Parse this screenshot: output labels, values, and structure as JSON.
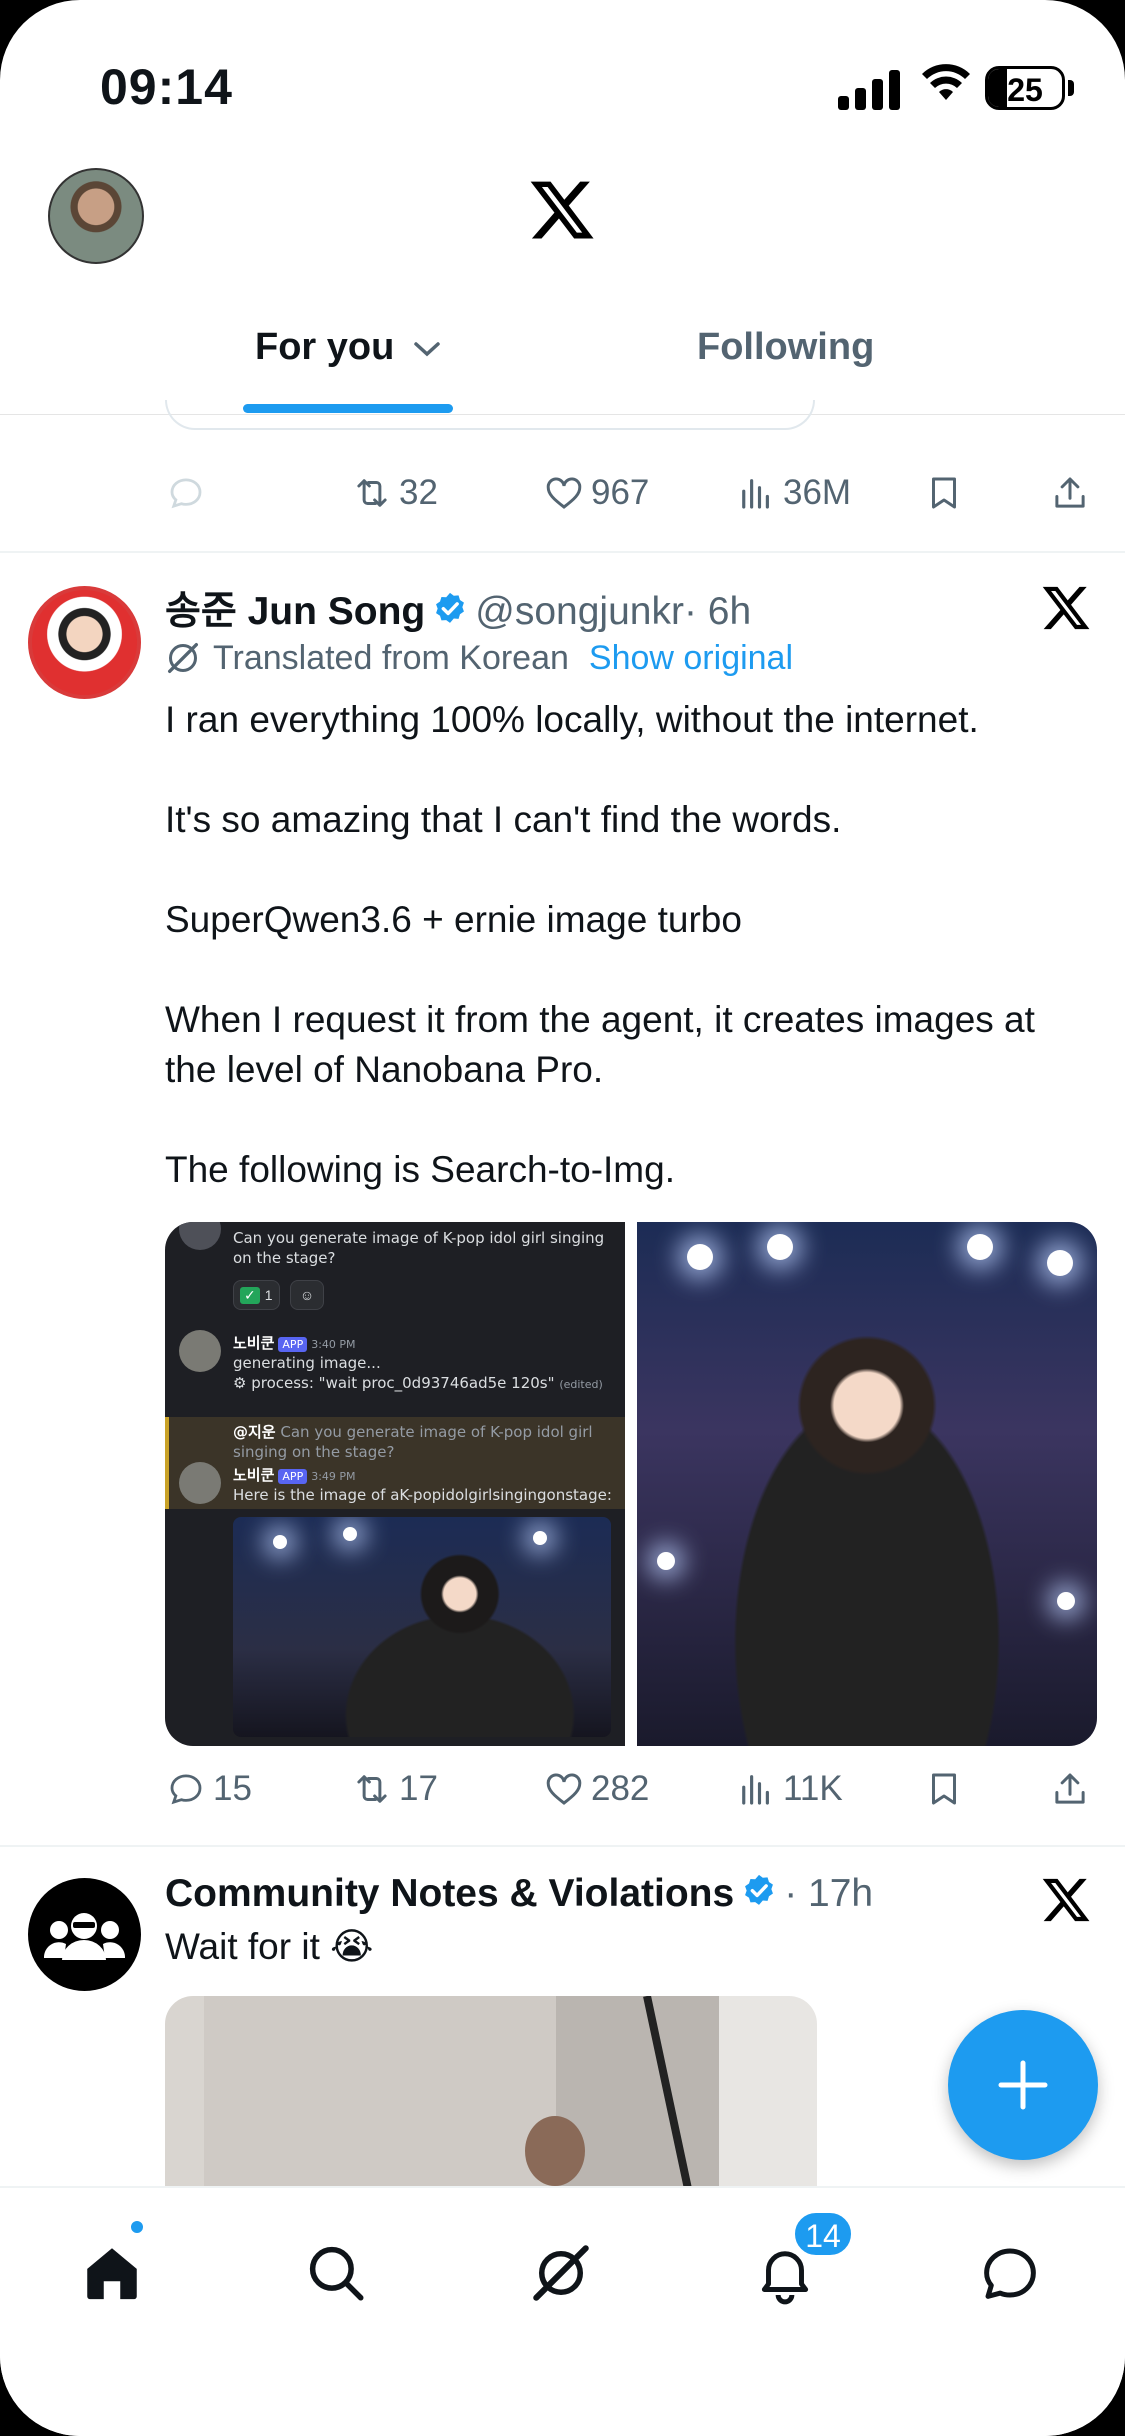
{
  "status_bar": {
    "time": "09:14",
    "battery": "25",
    "battery_level": 0.25
  },
  "header": {
    "tabs": [
      {
        "label": "For you",
        "selected": true
      },
      {
        "label": "Following",
        "selected": false
      }
    ]
  },
  "prev_tweet": {
    "retweets": "32",
    "likes": "967",
    "views": "36M"
  },
  "tweet": {
    "author_name": "송준 Jun Song",
    "handle": "@songjunkr",
    "time": "· 6h",
    "translated_label": "Translated from Korean",
    "show_original": "Show original",
    "paragraphs": [
      "I ran everything 100% locally, without the internet.",
      "It's so amazing that I can't find the words.",
      "SuperQwen3.6 + ernie image turbo",
      "When I request it from the agent, it creates images at the level of Nanobana Pro.",
      "The following is Search-to-Img."
    ],
    "discord": {
      "prompt": "Can you generate image of K-pop idol girl singing on the stage?",
      "reaction_count": "1",
      "bot_name": "노비쿤",
      "app_tag": "APP",
      "time1": "3:40 PM",
      "line_generating": "generating image...",
      "line_process": "⚙ process: \"wait proc_0d93746ad5e 120s\"",
      "edited": "(edited)",
      "reply_user": "@지운",
      "reply_text": "Can you generate image of K-pop idol girl singing on the stage?",
      "time2": "3:49 PM",
      "line_result": "Here is the image of aK-popidolgirlsingingonstage:"
    },
    "replies": "15",
    "retweets": "17",
    "likes": "282",
    "views": "11K"
  },
  "tweet2": {
    "author_name": "Community Notes & Violations",
    "time": "· 17h",
    "text": "Wait for it 😭"
  },
  "nav": {
    "notifications_badge": "14"
  },
  "colors": {
    "accent": "#1d9bf0",
    "text": "#0f1419",
    "muted": "#536471"
  }
}
